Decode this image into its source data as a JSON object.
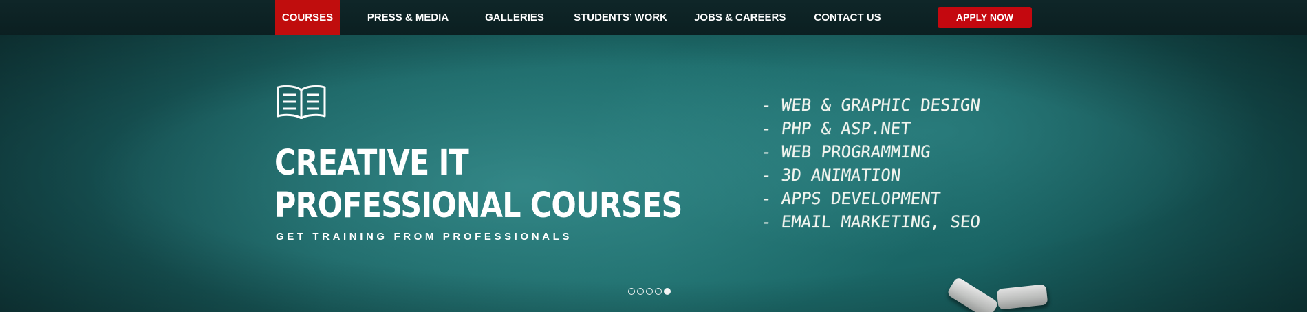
{
  "nav": {
    "items": [
      {
        "label": "COURSES",
        "active": true
      },
      {
        "label": "PRESS & MEDIA",
        "active": false
      },
      {
        "label": "GALLERIES",
        "active": false
      },
      {
        "label": "STUDENTS’ WORK",
        "active": false
      },
      {
        "label": "JOBS & CAREERS",
        "active": false
      },
      {
        "label": "CONTACT US",
        "active": false
      }
    ],
    "apply_label": "APPLY NOW"
  },
  "hero": {
    "icon": "open-book-icon",
    "title_line1": "CREATIVE IT",
    "title_line2": "PROFESSIONAL COURSES",
    "subtitle": "GET TRAINING FROM PROFESSIONALS",
    "courses": [
      "- WEB & GRAPHIC DESIGN",
      "- PHP & ASP.NET",
      "- WEB PROGRAMMING",
      "- 3D ANIMATION",
      "- APPS DEVELOPMENT",
      "- EMAIL MARKETING, SEO"
    ],
    "slider": {
      "count": 5,
      "active_index": 5
    }
  },
  "colors": {
    "accent_red": "#c00d0d",
    "nav_bg": "#0f2628",
    "chalkboard": "#1d6c6b",
    "text": "#ffffff"
  }
}
